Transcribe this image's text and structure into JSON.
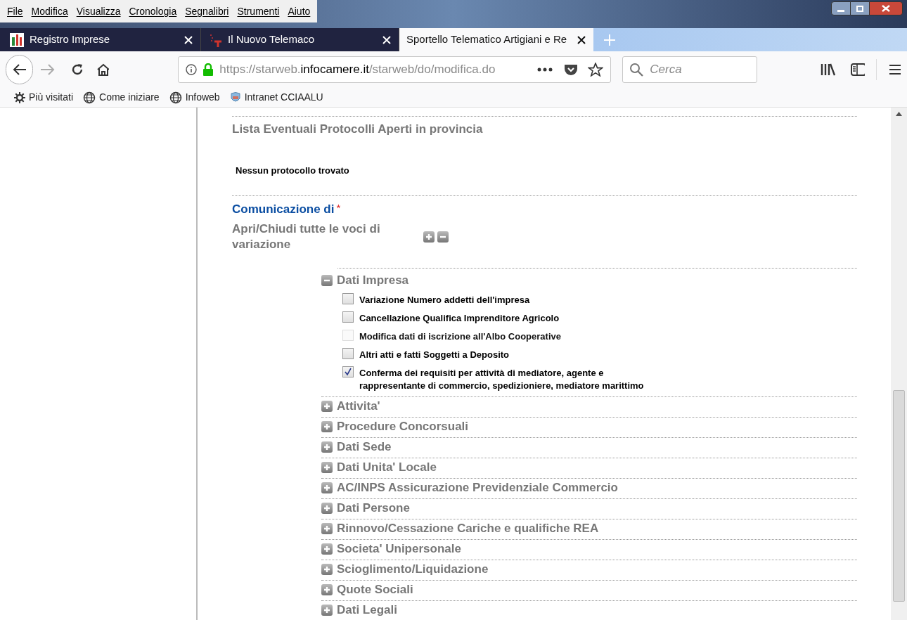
{
  "menu_bar": [
    "File",
    "Modifica",
    "Visualizza",
    "Cronologia",
    "Segnalibri",
    "Strumenti",
    "Aiuto"
  ],
  "tabs": [
    {
      "title": "Registro Imprese",
      "selected": false,
      "kind": "registro"
    },
    {
      "title": "Il Nuovo Telemaco",
      "selected": false,
      "kind": "telemaco"
    },
    {
      "title": "Sportello Telematico Artigiani e Re",
      "selected": true,
      "kind": "blank"
    }
  ],
  "address_bar": {
    "prefix": "https://starweb.",
    "domain": "infocamere.it",
    "path": "/starweb/do/modifica.do"
  },
  "search": {
    "placeholder": "Cerca"
  },
  "bookmarks": [
    {
      "label": "Più visitati",
      "kind": "gear"
    },
    {
      "label": "Come iniziare",
      "kind": "globe"
    },
    {
      "label": "Infoweb",
      "kind": "globe"
    },
    {
      "label": "Intranet CCIAALU",
      "kind": "shield"
    }
  ],
  "protocols": {
    "title": "Lista Eventuali Protocolli Aperti in provincia",
    "message": "Nessun protocollo trovato"
  },
  "communication": {
    "label": "Comunicazione di",
    "required_mark": "*",
    "toggle_all": "Apri/Chiudi tutte le voci di variazione"
  },
  "sections": [
    {
      "title": "Dati Impresa",
      "expanded": true,
      "options": [
        {
          "label": "Variazione Numero addetti dell'impresa",
          "checked": false,
          "disabled": false
        },
        {
          "label": "Cancellazione Qualifica Imprenditore Agricolo",
          "checked": false,
          "disabled": false
        },
        {
          "label": "Modifica dati di iscrizione all'Albo Cooperative",
          "checked": false,
          "disabled": true
        },
        {
          "label": "Altri atti e fatti Soggetti a Deposito",
          "checked": false,
          "disabled": false
        },
        {
          "label": "Conferma dei requisiti per attività di mediatore, agente e rappresentante di commercio, spedizioniere, mediatore marittimo",
          "checked": true,
          "disabled": false
        }
      ]
    },
    {
      "title": "Attivita'",
      "expanded": false
    },
    {
      "title": "Procedure Concorsuali",
      "expanded": false
    },
    {
      "title": "Dati Sede",
      "expanded": false
    },
    {
      "title": "Dati Unita' Locale",
      "expanded": false
    },
    {
      "title": "AC/INPS Assicurazione Previdenziale Commercio",
      "expanded": false
    },
    {
      "title": "Dati Persone",
      "expanded": false
    },
    {
      "title": "Rinnovo/Cessazione Cariche e qualifiche REA",
      "expanded": false
    },
    {
      "title": "Societa' Unipersonale",
      "expanded": false
    },
    {
      "title": "Scioglimento/Liquidazione",
      "expanded": false
    },
    {
      "title": "Quote Sociali",
      "expanded": false
    },
    {
      "title": "Dati Legali",
      "expanded": false
    }
  ]
}
